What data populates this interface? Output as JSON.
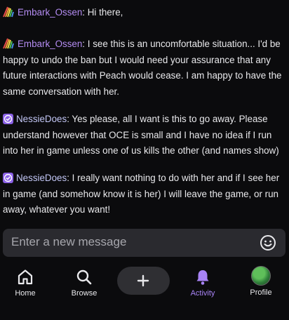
{
  "messages": [
    {
      "user": "Embark_Ossen",
      "badge": "rainbow-badge",
      "text": "Hi there,"
    },
    {
      "user": "Embark_Ossen",
      "badge": "rainbow-badge",
      "text": "I see this is an uncomfortable situation... I'd be happy to undo the ban but I would need your assurance that any future interactions with Peach would cease. I am happy to have the same conversation with her."
    },
    {
      "user": "NessieDoes",
      "badge": "verified-badge",
      "text": "Yes please, all I want is this to go away. Please understand however that OCE is small and I have no idea if I run into her in game unless one of us kills the other (and names show)"
    },
    {
      "user": "NessieDoes",
      "badge": "verified-badge",
      "text": "I really want nothing to do with her and if I see her in game (and somehow know it is her) I will leave the game, or run away, whatever you want!"
    }
  ],
  "composer": {
    "placeholder": "Enter a new message",
    "emoji_icon": "smiley-icon"
  },
  "nav": {
    "items": [
      {
        "label": "Home",
        "icon": "home-icon"
      },
      {
        "label": "Browse",
        "icon": "search-icon"
      },
      {
        "label": "",
        "icon": "plus-icon"
      },
      {
        "label": "Activity",
        "icon": "bell-icon",
        "active": true
      },
      {
        "label": "Profile",
        "icon": "avatar"
      }
    ]
  },
  "colors": {
    "background": "#0b0b0d",
    "username_ossen": "#b48cf2",
    "username_nessie": "#c3c7f6",
    "accent": "#a883f5"
  }
}
